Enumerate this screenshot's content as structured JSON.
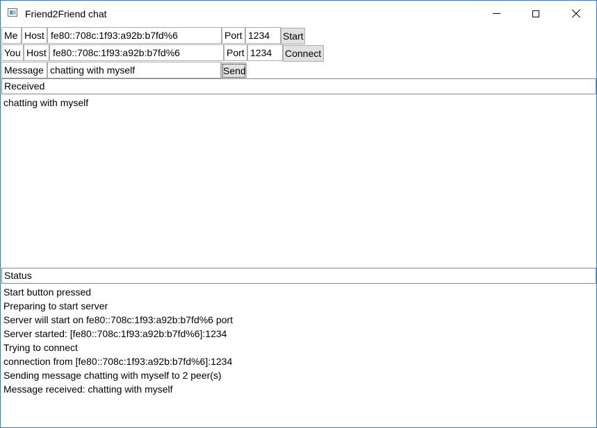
{
  "window": {
    "title": "Friend2Friend chat",
    "minimize_icon": "minimize-icon",
    "maximize_icon": "maximize-icon",
    "close_icon": "close-icon"
  },
  "me_row": {
    "label": "Me",
    "host_label": "Host",
    "host_value": "fe80::708c:1f93:a92b:b7fd%6",
    "port_label": "Port",
    "port_value": "1234",
    "button_label": "Start"
  },
  "you_row": {
    "label": "You",
    "host_label": "Host",
    "host_value": "fe80::708c:1f93:a92b:b7fd%6",
    "port_label": "Port",
    "port_value": "1234",
    "button_label": "Connect"
  },
  "message_row": {
    "label": "Message",
    "value": "chatting with myself",
    "button_label": "Send"
  },
  "received": {
    "header": "Received",
    "lines": [
      "chatting with myself"
    ]
  },
  "status": {
    "header": "Status",
    "lines": [
      "Start button pressed",
      "Preparing to start server",
      "Server will start on fe80::708c:1f93:a92b:b7fd%6 port",
      "Server started: [fe80::708c:1f93:a92b:b7fd%6]:1234",
      "Trying to connect",
      "connection from [fe80::708c:1f93:a92b:b7fd%6]:1234",
      "Sending message chatting with myself to 2 peer(s)",
      "Message received: chatting with myself"
    ]
  }
}
